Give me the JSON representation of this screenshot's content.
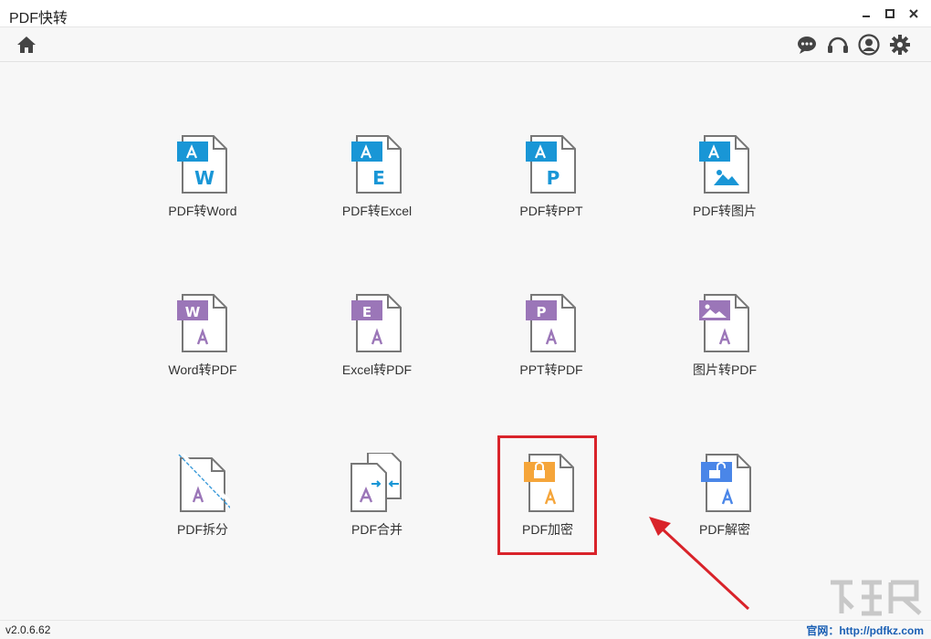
{
  "window": {
    "title": "PDF快转"
  },
  "toolbar": {
    "home_icon": "home-icon",
    "right_icons": [
      "chat-icon",
      "headset-icon",
      "user-icon",
      "gear-icon"
    ]
  },
  "colors": {
    "blue": "#1996d6",
    "purple": "#9b76b8",
    "orange": "#f5a53a",
    "lock_blue": "#4a86e8",
    "highlight": "#d9232a",
    "arrow": "#d9232a"
  },
  "tiles": {
    "row1": [
      {
        "label": "PDF转Word",
        "letter": "W"
      },
      {
        "label": "PDF转Excel",
        "letter": "E"
      },
      {
        "label": "PDF转PPT",
        "letter": "P"
      },
      {
        "label": "PDF转图片",
        "letter": ""
      }
    ],
    "row2": [
      {
        "label": "Word转PDF",
        "letter": "W"
      },
      {
        "label": "Excel转PDF",
        "letter": "E"
      },
      {
        "label": "PPT转PDF",
        "letter": "P"
      },
      {
        "label": "图片转PDF",
        "letter": ""
      }
    ],
    "row3": [
      {
        "label": "PDF拆分"
      },
      {
        "label": "PDF合并"
      },
      {
        "label": "PDF加密"
      },
      {
        "label": "PDF解密"
      }
    ]
  },
  "status": {
    "version": "v2.0.6.62",
    "site": "官网：http://pdfkz.com"
  }
}
